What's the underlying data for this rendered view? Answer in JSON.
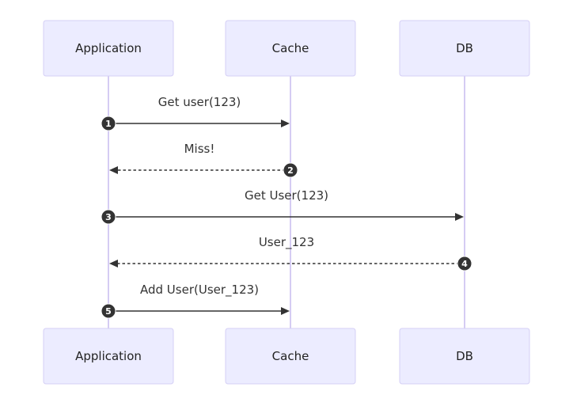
{
  "diagram": {
    "type": "sequence",
    "participants": [
      {
        "id": "app",
        "label": "Application"
      },
      {
        "id": "cache",
        "label": "Cache"
      },
      {
        "id": "db",
        "label": "DB"
      }
    ],
    "messages": [
      {
        "seq": "1",
        "from": "app",
        "to": "cache",
        "label": "Get user(123)",
        "style": "solid"
      },
      {
        "seq": "2",
        "from": "cache",
        "to": "app",
        "label": "Miss!",
        "style": "dashed"
      },
      {
        "seq": "3",
        "from": "app",
        "to": "db",
        "label": "Get User(123)",
        "style": "solid"
      },
      {
        "seq": "4",
        "from": "db",
        "to": "app",
        "label": "User_123",
        "style": "dashed"
      },
      {
        "seq": "5",
        "from": "app",
        "to": "cache",
        "label": "Add User(User_123)",
        "style": "solid"
      }
    ],
    "colors": {
      "actor_fill": "#ECECFF",
      "actor_border": "#D5CFF5",
      "lifeline": "#D5CCF3",
      "message": "#333333"
    }
  }
}
